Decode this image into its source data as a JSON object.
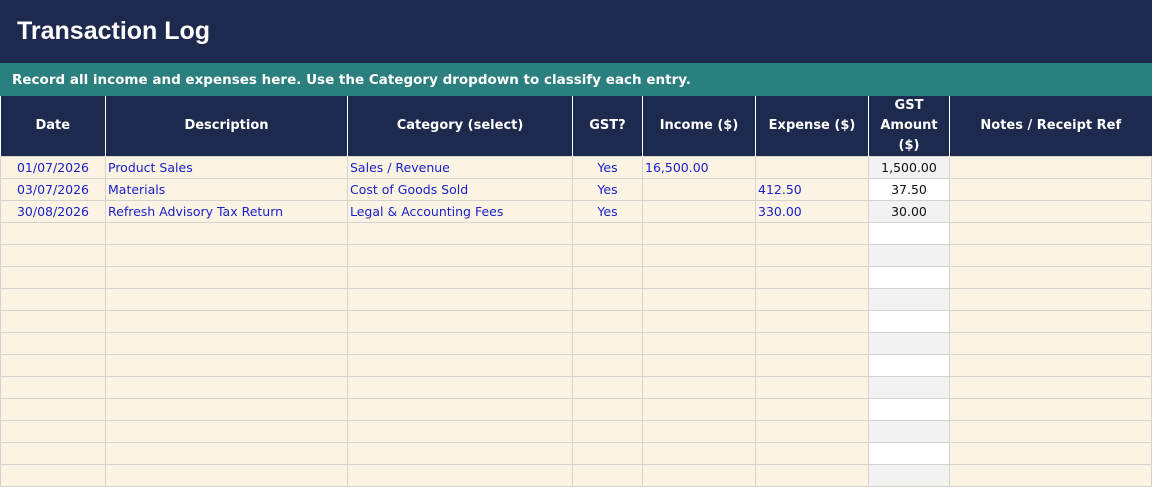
{
  "title": "Transaction Log",
  "banner": "Record all income and expenses here. Use the Category dropdown to classify each entry.",
  "columns": [
    "Date",
    "Description",
    "Category (select)",
    "GST?",
    "Income ($)",
    "Expense ($)",
    "GST\nAmount ($)",
    "Notes / Receipt Ref"
  ],
  "rows": [
    {
      "date": "01/07/2026",
      "description": "Product Sales",
      "category": "Sales / Revenue",
      "gst": "Yes",
      "income": "16,500.00",
      "expense": "",
      "gst_amount": "1,500.00",
      "notes": ""
    },
    {
      "date": "03/07/2026",
      "description": "Materials",
      "category": "Cost of Goods Sold",
      "gst": "Yes",
      "income": "",
      "expense": "412.50",
      "gst_amount": "37.50",
      "notes": ""
    },
    {
      "date": "30/08/2026",
      "description": "Refresh Advisory Tax Return",
      "category": "Legal & Accounting Fees",
      "gst": "Yes",
      "income": "",
      "expense": "330.00",
      "gst_amount": "30.00",
      "notes": ""
    }
  ],
  "empty_rows": 12,
  "colors": {
    "header_bg": "#1d2a4d",
    "banner_bg": "#2b7f7f",
    "cell_bg": "#fbf4e4",
    "entry_text": "#1a20c8"
  }
}
